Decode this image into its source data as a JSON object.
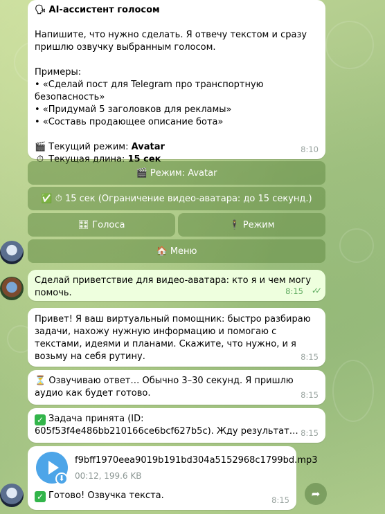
{
  "colors": {
    "bubble_in": "#ffffff",
    "bubble_out": "#eeffde",
    "keyboard_button": "#6a8c4a",
    "accent": "#4da5e8",
    "check": "#32b54a"
  },
  "msg_intro": {
    "title_icon": "speaking-head-icon",
    "title": "AI-ассистент голосом",
    "para": "Напишите, что нужно сделать. Я отвечу текстом и сразу пришлю озвучку выбранным голосом.",
    "examples_label": "Примеры:",
    "examples": [
      "• «Сделай пост для Telegram про транспортную безопасность»",
      "• «Придумай 5 заголовков для рекламы»",
      "• «Составь продающее описание бота»"
    ],
    "mode_label": "Текущий режим: ",
    "mode_value": "Avatar",
    "length_label": "Текущая длина: ",
    "length_value": "15 сек",
    "time": "8:10"
  },
  "keyboard": {
    "mode_btn": "🎬 Режим: Avatar",
    "len_btn": "✅ ⏱ 15 сек (Ограничение видео-аватара: до 15 секунд.)",
    "voices_btn": "🎛 Голоса",
    "mode2_btn": "🕴 Режим",
    "menu_btn": "🏠 Меню"
  },
  "msg_user": {
    "text": "Сделай приветствие для видео-аватара: кто я и чем могу помочь.",
    "time": "8:15"
  },
  "msg_reply": {
    "text": "Привет! Я ваш виртуальный помощник: быстро разбираю задачи, нахожу нужную информацию и помогаю с текстами, идеями и планами. Скажите, что нужно, и я возьму на себя рутину.",
    "time": "8:15"
  },
  "msg_voicing": {
    "text": "⏳ Озвучиваю ответ… Обычно 3–30 секунд. Я пришлю аудио как будет готово.",
    "time": "8:15"
  },
  "msg_task": {
    "text": "Задача принята (ID: 605f53f4e486bb210166ce6bcf627b5c). Жду результат…",
    "time": "8:15"
  },
  "msg_audio": {
    "filename": "f9bff1970eea9019b191bd304a5152968c1799bd.mp3",
    "meta": "00:12, 199.6 KB",
    "caption": "Готово! Озвучка текста.",
    "time": "8:15"
  }
}
